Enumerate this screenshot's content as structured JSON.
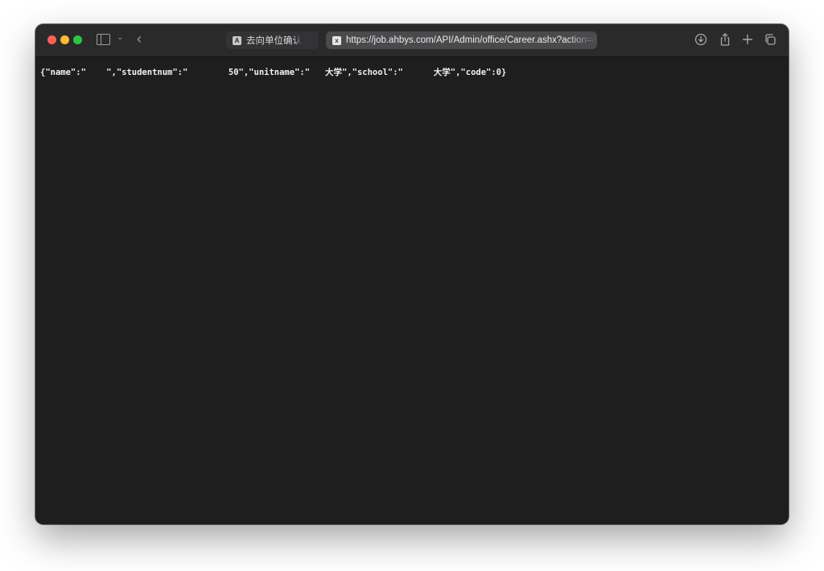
{
  "browser": {
    "tabs": [
      {
        "favicon": "A",
        "title": "去向单位确认",
        "active": false
      },
      {
        "favicon": "x",
        "title": "https://job.ahbys.com/API/Admin/office/Career.ashx?action=auth",
        "active": true
      }
    ],
    "icons": {
      "sidebar": "sidebar-icon",
      "chevron": "chevron-down-icon",
      "back": "back-chevron-icon",
      "download": "download-icon",
      "share": "share-icon",
      "new_tab": "plus-icon",
      "tab_overview": "tab-overview-icon"
    },
    "colors": {
      "close": "#fe5f57",
      "minimize": "#febc2e",
      "maximize": "#28c840"
    }
  },
  "page": {
    "json_text": "{\"name\":\"    \",\"studentnum\":\"        50\",\"unitname\":\"   大学\",\"school\":\"      大学\",\"code\":0}"
  }
}
